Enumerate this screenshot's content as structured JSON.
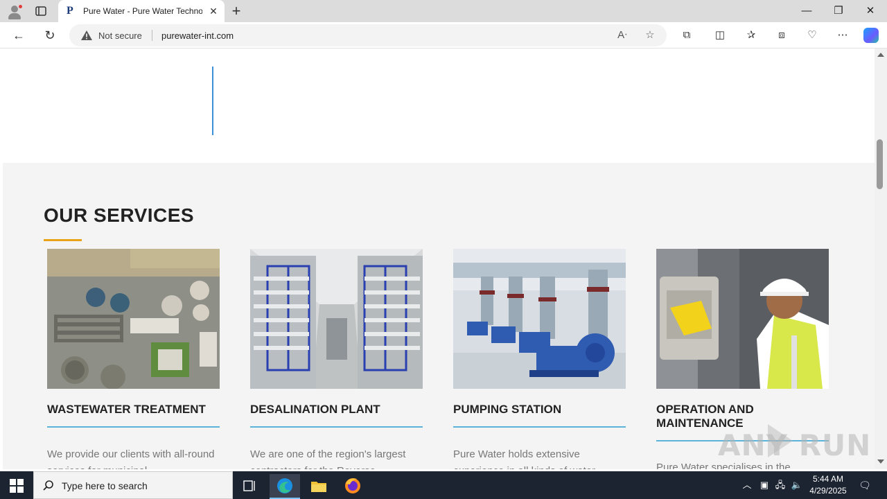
{
  "browser": {
    "tab_title": "Pure Water - Pure Water Technologies",
    "tab_favicon_letter": "P",
    "security_label": "Not secure",
    "url": "purewater-int.com"
  },
  "page": {
    "services": {
      "title": "OUR SERVICES",
      "cards": [
        {
          "title": "WASTEWATER TREATMENT",
          "text": "We provide our clients with all-round services for municipal"
        },
        {
          "title": "DESALINATION PLANT",
          "text": "We are one of the region's largest contractors for the Reverse"
        },
        {
          "title": "PUMPING STATION",
          "text": "Pure Water holds extensive experience in all kinds of water"
        },
        {
          "title": "OPERATION AND MAINTENANCE",
          "text": "Pure Water specialises in the"
        }
      ]
    },
    "watermark": "ANY RUN"
  },
  "taskbar": {
    "search_placeholder": "Type here to search",
    "time": "5:44 AM",
    "date": "4/29/2025"
  },
  "colors": {
    "accent_underline": "#e8a317",
    "card_rule": "#5bb3d9",
    "blue_line": "#3a8fd6",
    "taskbar": "#1c2331"
  }
}
